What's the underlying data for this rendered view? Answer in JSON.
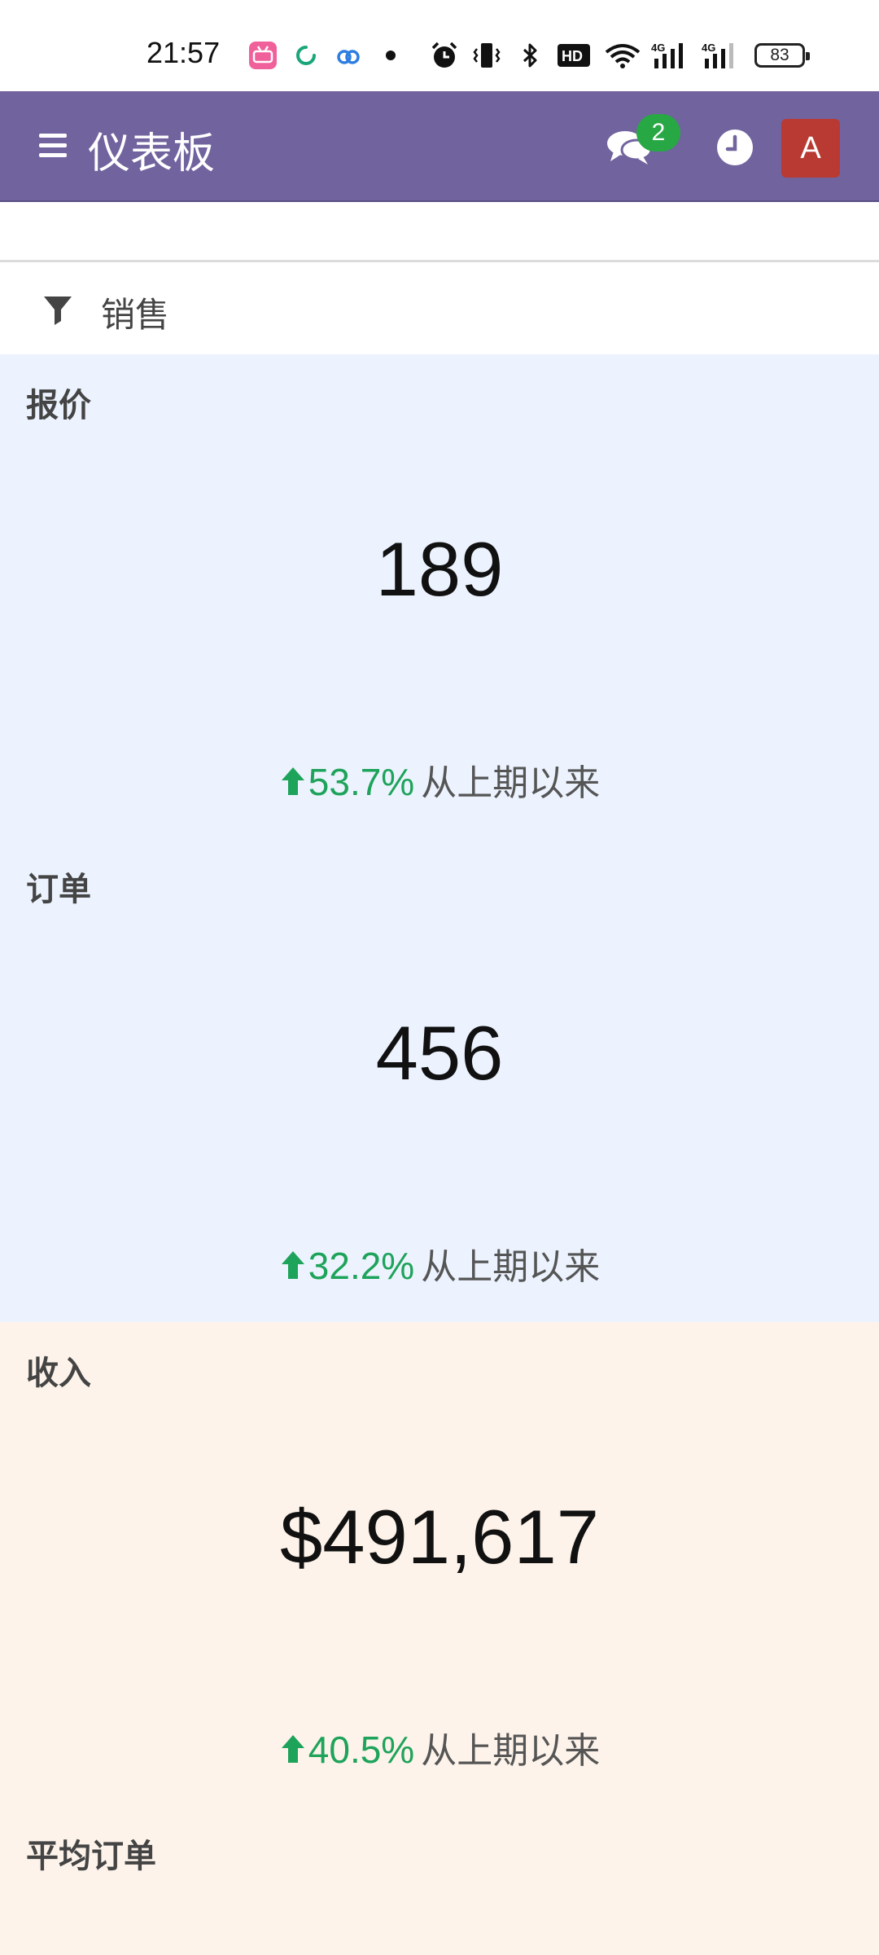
{
  "status_bar": {
    "time": "21:57",
    "battery": "83",
    "icons": [
      "bilibili-icon",
      "sync-icon",
      "cloud-icon",
      "dot-icon",
      "alarm-icon",
      "vibrate-icon",
      "bluetooth-icon",
      "hd-icon",
      "wifi-icon",
      "signal-4g-icon",
      "signal-4g-icon",
      "battery-icon"
    ]
  },
  "app_bar": {
    "title": "仪表板",
    "chat_badge": "2",
    "avatar_letter": "A",
    "background_color": "#71639e"
  },
  "filter": {
    "label": "销售"
  },
  "kpis": [
    {
      "label": "报价",
      "value": "189",
      "trend_pct": "53.7%",
      "trend_text": "从上期以来",
      "bg": "#ecf3fe"
    },
    {
      "label": "订单",
      "value": "456",
      "trend_pct": "32.2%",
      "trend_text": "从上期以来",
      "bg": "#ecf3fe"
    },
    {
      "label": "收入",
      "value": "$491,617",
      "trend_pct": "40.5%",
      "trend_text": "从上期以来",
      "bg": "#fdf3ea"
    },
    {
      "label": "平均订单"
    }
  ],
  "colors": {
    "trend_up": "#1ea35a",
    "badge": "#28a745",
    "avatar": "#b83a32"
  }
}
